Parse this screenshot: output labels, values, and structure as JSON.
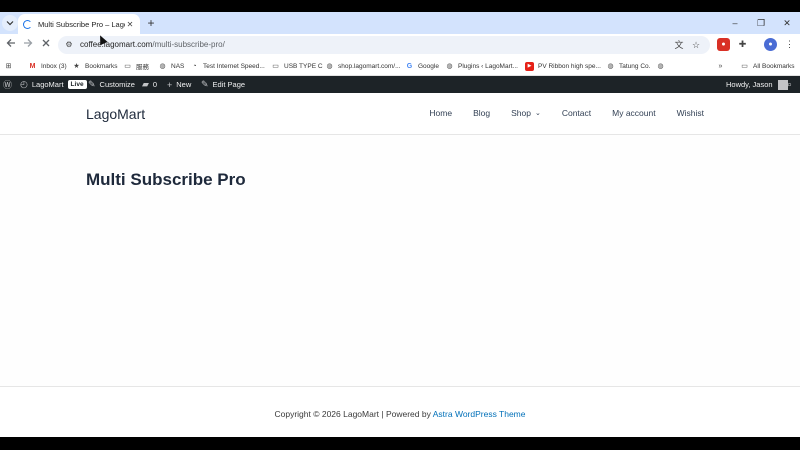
{
  "browser": {
    "tab": {
      "title": "Multi Subscribe Pro – LagoMart"
    },
    "new_tab_label": "+",
    "window_controls": {
      "minimize": "–",
      "restore": "❐",
      "close": "✕"
    },
    "url": {
      "host": "coffee.lagomart.com",
      "path": "/multi-subscribe-pro/"
    },
    "bookmarks": [
      {
        "icon": "gmail-icon",
        "label": "Inbox (3)"
      },
      {
        "icon": "star-icon",
        "label": "Bookmarks"
      },
      {
        "icon": "folder-icon",
        "label": "服務"
      },
      {
        "icon": "globe-icon",
        "label": "NAS"
      },
      {
        "icon": "speedtest-icon",
        "label": "Test Internet Speed..."
      },
      {
        "icon": "folder-icon",
        "label": "USB TYPE C"
      },
      {
        "icon": "globe-icon",
        "label": "shop.lagomart.com/..."
      },
      {
        "icon": "google-icon",
        "label": "Google"
      },
      {
        "icon": "globe-icon",
        "label": "Plugins ‹ LagoMart..."
      },
      {
        "icon": "youtube-icon",
        "label": "PV Ribbon high spe..."
      },
      {
        "icon": "globe-icon",
        "label": "Tatung Co."
      },
      {
        "icon": "globe-icon",
        "label": ""
      }
    ],
    "all_bookmarks_label": "All Bookmarks"
  },
  "adminbar": {
    "site_name": "LagoMart",
    "live_badge": "Live",
    "customize": "Customize",
    "comments_count": "0",
    "new_label": "New",
    "edit_page": "Edit Page",
    "howdy": "Howdy, Jason"
  },
  "site": {
    "title": "LagoMart",
    "menu": [
      {
        "label": "Home"
      },
      {
        "label": "Blog"
      },
      {
        "label": "Shop",
        "has_dropdown": true
      },
      {
        "label": "Contact"
      },
      {
        "label": "My account"
      },
      {
        "label": "Wishist"
      }
    ]
  },
  "page": {
    "title": "Multi Subscribe Pro"
  },
  "footer": {
    "prefix": "Copyright © 2026 LagoMart | Powered by ",
    "link": "Astra WordPress Theme"
  },
  "colors": {
    "accent": "#0170b9",
    "adminbar": "#1d2327",
    "tabstrip": "#d3e3fd"
  }
}
